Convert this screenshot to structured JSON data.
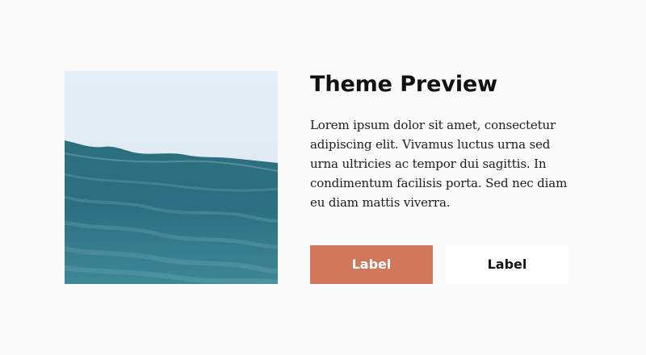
{
  "preview": {
    "title": "Theme Preview",
    "body": "Lorem ipsum dolor sit amet, consectetur adipiscing elit. Vivamus luctus urna sed urna ultricies ac tempor dui sagittis. In condimentum facilisis porta. Sed nec diam eu diam mattis viverra.",
    "image": "ocean-waves-photo",
    "primary_button": {
      "label": "Label",
      "color": "#d1775b"
    },
    "secondary_button": {
      "label": "Label",
      "color": "#ffffff"
    }
  }
}
